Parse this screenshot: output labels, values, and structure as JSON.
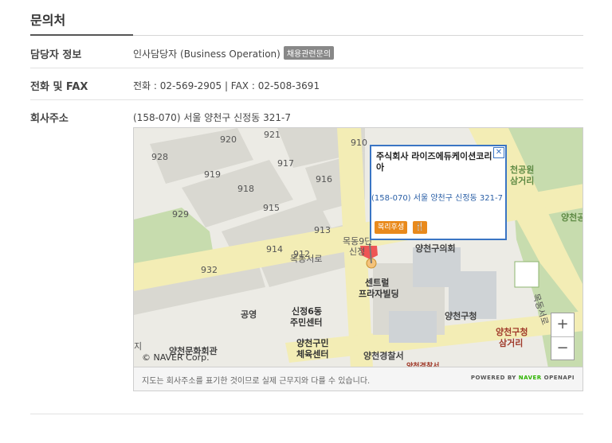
{
  "section": {
    "title": "문의처"
  },
  "rows": [
    {
      "label": "담당자 정보",
      "value": "인사담당자 (Business Operation)",
      "badge": "채용관련문의"
    },
    {
      "label": "전화 및 FAX",
      "value": "전화 : 02-569-2905 | FAX : 02-508-3691"
    },
    {
      "label": "회사주소",
      "value": "(158-070) 서울 양천구 신정동 321-7"
    }
  ],
  "map": {
    "labels": {
      "l928": "928",
      "l920": "920",
      "l921": "921",
      "l910": "910",
      "l919": "919",
      "l917": "917",
      "l916": "916",
      "l918": "918",
      "l929": "929",
      "l915": "915",
      "l913": "913",
      "l914": "914",
      "l932": "932",
      "l912": "912",
      "mokdong_road": "목동서로",
      "mokdong_sub": "목동9단",
      "sinjeong": "신정",
      "yangcheon_council": "양천구의회",
      "central1": "센트럴",
      "central2": "프라자빌딩",
      "park1": "천공원",
      "park2": "삼거리",
      "yangcheon_right": "양천공",
      "gongyeong": "공영",
      "sinjeong6_1": "신정6동",
      "sinjeong6_2": "주민센터",
      "yangcheon_office": "양천구청",
      "cross1": "양천구청",
      "cross2": "삼거리",
      "culture": "양천문화회관",
      "sports1": "양천구민",
      "sports2": "체육센터",
      "police": "양천경찰서",
      "police2": "양천경찰서",
      "ji": "지",
      "vertical_road": "목동서로"
    },
    "popup": {
      "title": "주식회사 라이즈에듀케이션코리아",
      "address": "(158-070) 서울 양천구 신정동 321-7",
      "welfare_button": "복리후생",
      "close_icon": "close-icon",
      "restaurant_icon": "fork-knife-icon"
    },
    "zoom_in": "+",
    "zoom_out": "−",
    "copyright": "© NAVER Corp."
  },
  "footer": {
    "note": "지도는 회사주소를 표기한 것이므로 실제 근무지와 다를 수 있습니다.",
    "powered_prefix": "POWERED BY",
    "powered_brand": "NAVER",
    "powered_suffix": "OPENAPI"
  },
  "colors": {
    "accent": "#3a75c4",
    "button": "#e98a1c",
    "road": "#f3edb5",
    "park": "#c7dcae"
  }
}
